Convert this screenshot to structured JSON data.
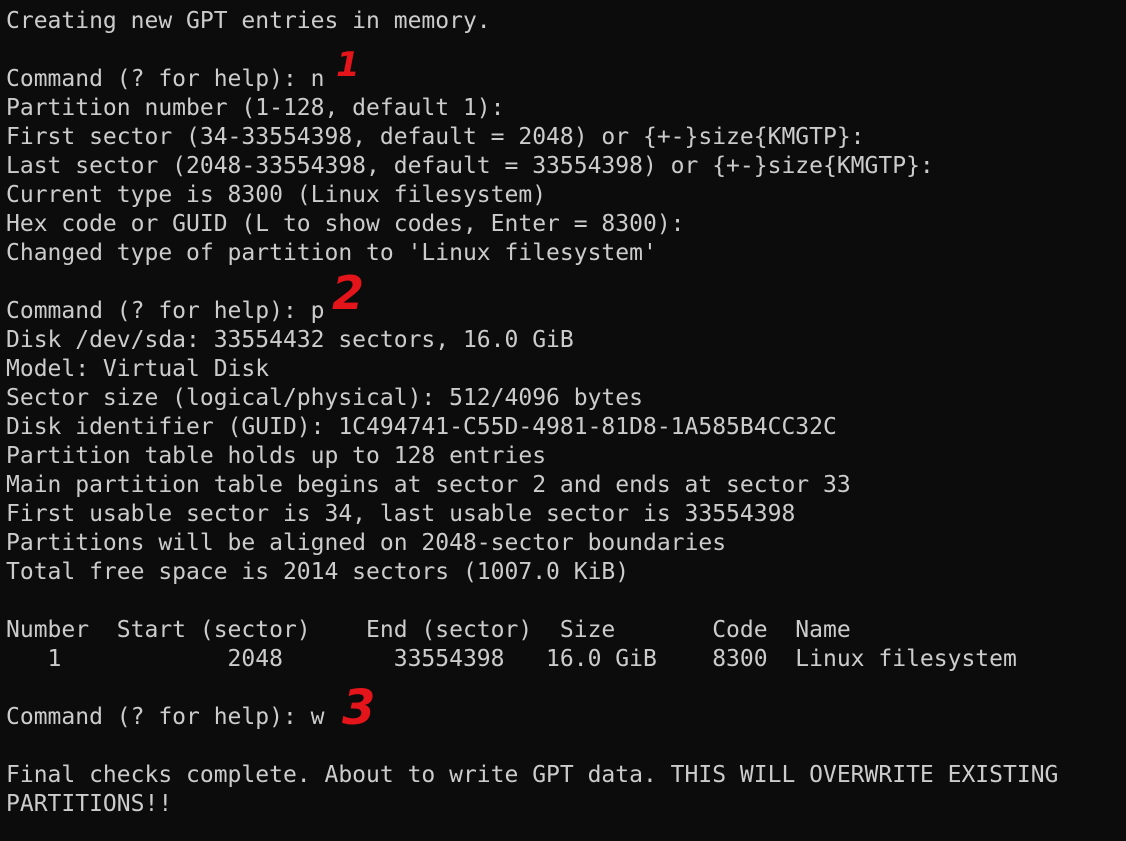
{
  "terminal": {
    "lines": [
      "Creating new GPT entries in memory.",
      "",
      "Command (? for help): n",
      "Partition number (1-128, default 1):",
      "First sector (34-33554398, default = 2048) or {+-}size{KMGTP}:",
      "Last sector (2048-33554398, default = 33554398) or {+-}size{KMGTP}:",
      "Current type is 8300 (Linux filesystem)",
      "Hex code or GUID (L to show codes, Enter = 8300):",
      "Changed type of partition to 'Linux filesystem'",
      "",
      "Command (? for help): p",
      "Disk /dev/sda: 33554432 sectors, 16.0 GiB",
      "Model: Virtual Disk",
      "Sector size (logical/physical): 512/4096 bytes",
      "Disk identifier (GUID): 1C494741-C55D-4981-81D8-1A585B4CC32C",
      "Partition table holds up to 128 entries",
      "Main partition table begins at sector 2 and ends at sector 33",
      "First usable sector is 34, last usable sector is 33554398",
      "Partitions will be aligned on 2048-sector boundaries",
      "Total free space is 2014 sectors (1007.0 KiB)",
      "",
      "Number  Start (sector)    End (sector)  Size       Code  Name",
      "   1            2048        33554398   16.0 GiB    8300  Linux filesystem",
      "",
      "Command (? for help): w",
      "",
      "Final checks complete. About to write GPT data. THIS WILL OVERWRITE EXISTING",
      "PARTITIONS!!"
    ]
  },
  "annotations": {
    "marker_1": "1",
    "marker_2": "2",
    "marker_3": "3",
    "color": "#e3151a"
  },
  "colors": {
    "background": "#0c0c0c",
    "foreground": "#cccccc"
  }
}
